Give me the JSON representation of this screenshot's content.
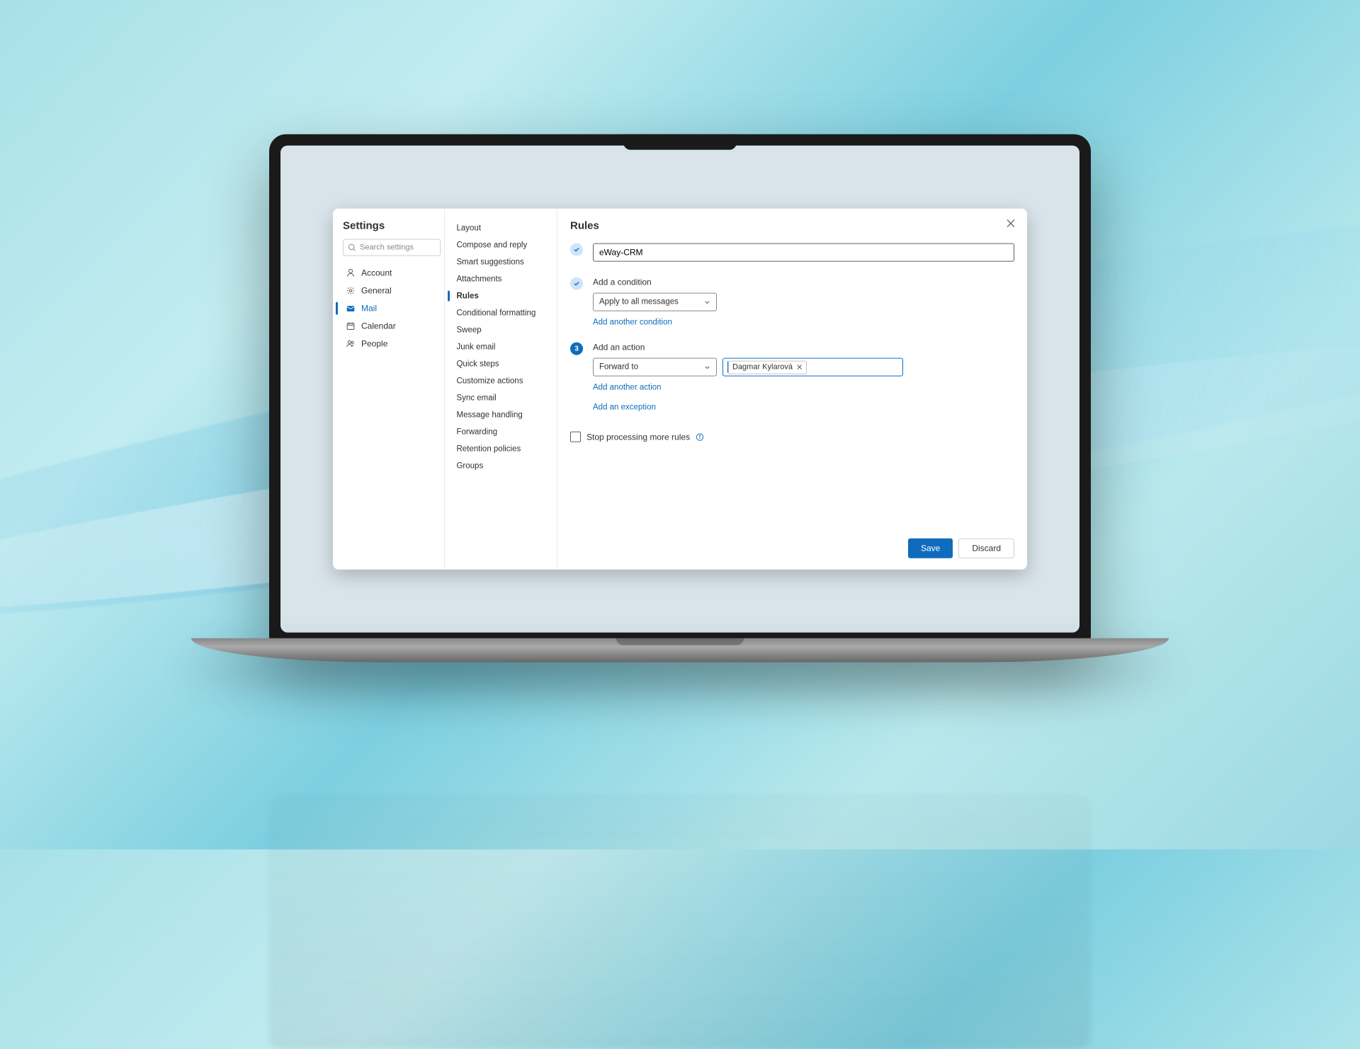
{
  "settings": {
    "title": "Settings",
    "search_placeholder": "Search settings",
    "nav": {
      "account": "Account",
      "general": "General",
      "mail": "Mail",
      "calendar": "Calendar",
      "people": "People"
    }
  },
  "mail_subnav": {
    "layout": "Layout",
    "compose": "Compose and reply",
    "smart": "Smart suggestions",
    "attachments": "Attachments",
    "rules": "Rules",
    "conditional": "Conditional formatting",
    "sweep": "Sweep",
    "junk": "Junk email",
    "quick": "Quick steps",
    "customize": "Customize actions",
    "sync": "Sync email",
    "handling": "Message handling",
    "forwarding": "Forwarding",
    "retention": "Retention policies",
    "groups": "Groups"
  },
  "rules_panel": {
    "title": "Rules",
    "rule_name": "eWay-CRM",
    "step2_label": "Add a condition",
    "condition_value": "Apply to all messages",
    "add_condition_link": "Add another condition",
    "step3_number": "3",
    "step3_label": "Add an action",
    "action_value": "Forward to",
    "recipient": "Dagmar Kylarová",
    "add_action_link": "Add another action",
    "add_exception_link": "Add an exception",
    "stop_processing": "Stop processing more rules",
    "save": "Save",
    "discard": "Discard"
  }
}
